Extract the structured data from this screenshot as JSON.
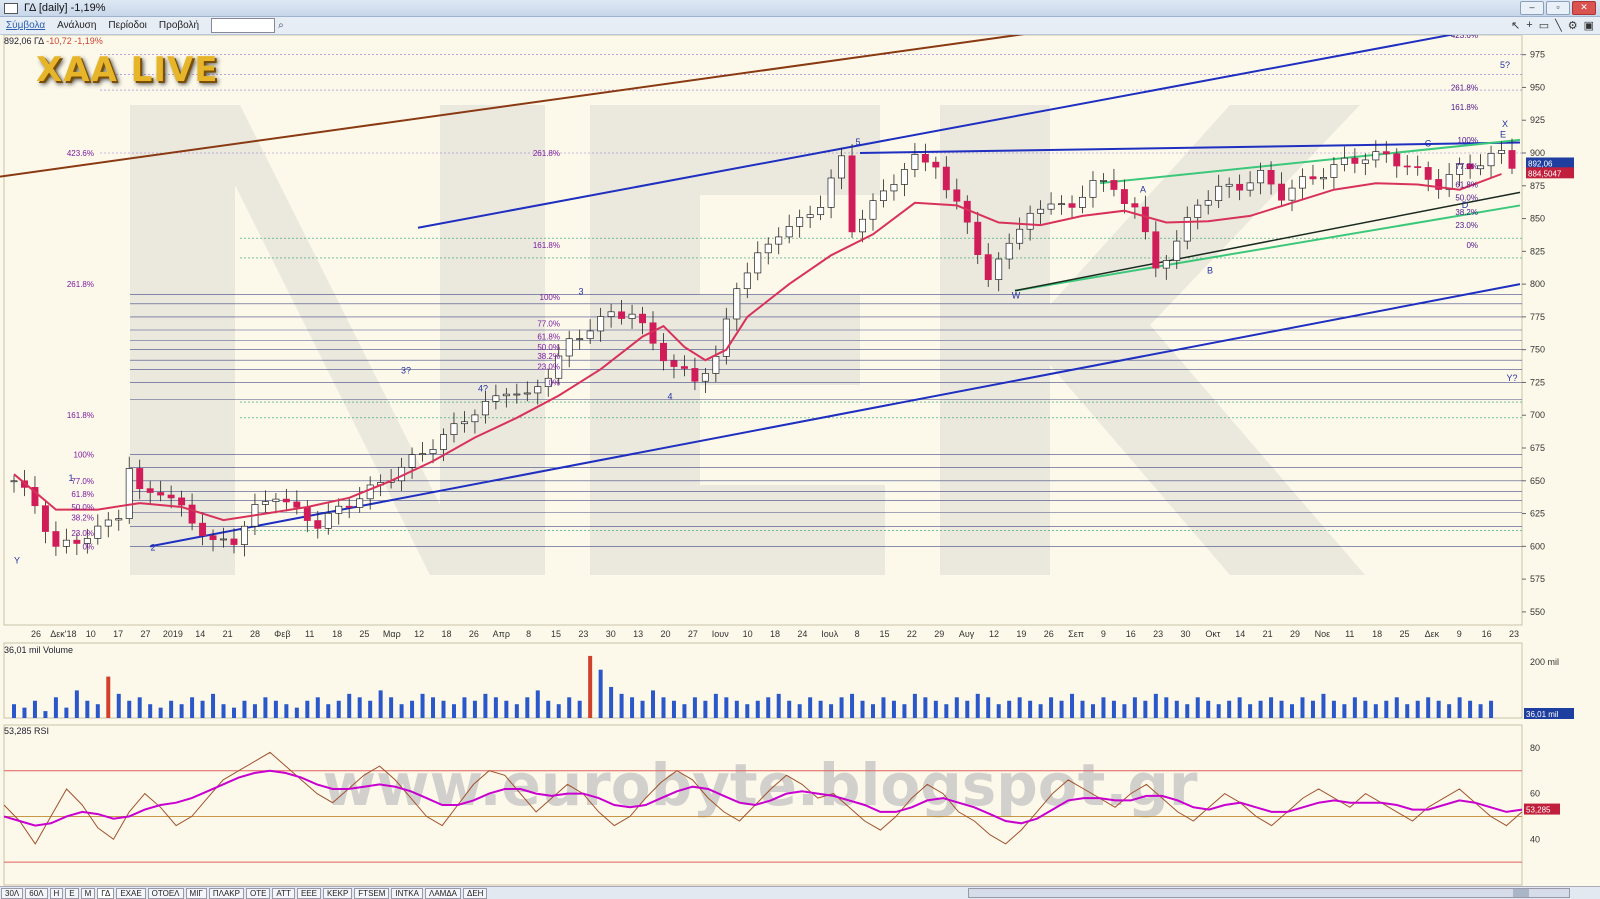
{
  "window": {
    "title": "ΓΔ [daily] -1,19%"
  },
  "menu": {
    "items": [
      "Σύμβολα",
      "Ανάλυση",
      "Περίοδοι",
      "Προβολή"
    ],
    "active_index": 0,
    "search_value": ""
  },
  "info_line": {
    "price": "892,06",
    "symbol": "ΓΔ",
    "change": "-10,72",
    "change_pct": "-1,19%"
  },
  "logo": "XAA LIVE",
  "watermark_url": "www.eurobyte.blogspot.gr",
  "price_tags": {
    "last": "892,06",
    "ma": "884,5047"
  },
  "volume_label": "36,01 mil Volume",
  "volume_tag": "36,01 mil",
  "rsi_label": "53,285 RSI",
  "rsi_tag": "53,285",
  "tabs": [
    "30Λ",
    "60Λ",
    "Η",
    "Ε",
    "Μ",
    "ΓΔ",
    "ΕΧΑΕ",
    "ΟΤΟΕΛ",
    "ΜΙΓ",
    "ΠΛΑΚΡ",
    "ΟΤΕ",
    "ΑΤΤ",
    "ΕΕΕ",
    "ΚΕΚΡ",
    "FTSEM",
    "ΙΝΤΚΑ",
    "ΛΑΜΔΑ",
    "ΔΕΗ"
  ],
  "active_tab": 5,
  "colors": {
    "up": "#ffffff",
    "down": "#d01c58",
    "ma": "#d8325a",
    "blue_line": "#1f2fc0",
    "brown_line": "#8a3a12",
    "green_line": "#3cc87a",
    "rsi_fast": "#a0522d",
    "rsi_slow": "#c800d0",
    "vol_blue": "#2a57c9",
    "vol_red": "#d0402a"
  },
  "chart_data": {
    "type": "candlestick",
    "x_ticks": [
      "26",
      "Δεκ'18",
      "10",
      "17",
      "27",
      "2019",
      "14",
      "21",
      "28",
      "Φεβ",
      "11",
      "18",
      "25",
      "Μαρ",
      "12",
      "18",
      "26",
      "Απρ",
      "8",
      "15",
      "23",
      "30",
      "13",
      "20",
      "27",
      "Ιουν",
      "10",
      "18",
      "24",
      "Ιουλ",
      "8",
      "15",
      "22",
      "29",
      "Αυγ",
      "12",
      "19",
      "26",
      "Σεπ",
      "9",
      "16",
      "23",
      "30",
      "Οκτ",
      "14",
      "21",
      "29",
      "Νοε",
      "11",
      "18",
      "25",
      "Δεκ",
      "9",
      "16",
      "23"
    ],
    "y_ticks": [
      550,
      575,
      600,
      625,
      650,
      675,
      700,
      725,
      750,
      775,
      800,
      825,
      850,
      875,
      900,
      925,
      950,
      975
    ],
    "ylim": [
      540,
      990
    ],
    "close_path": [
      [
        0,
        650
      ],
      [
        2,
        632
      ],
      [
        4,
        598
      ],
      [
        6,
        605
      ],
      [
        8,
        612
      ],
      [
        10,
        625
      ],
      [
        11,
        660
      ],
      [
        12,
        640
      ],
      [
        14,
        643
      ],
      [
        16,
        628
      ],
      [
        17,
        620
      ],
      [
        19,
        602
      ],
      [
        21,
        605
      ],
      [
        23,
        628
      ],
      [
        25,
        640
      ],
      [
        27,
        626
      ],
      [
        29,
        617
      ],
      [
        31,
        628
      ],
      [
        33,
        638
      ],
      [
        35,
        648
      ],
      [
        37,
        660
      ],
      [
        39,
        672
      ],
      [
        41,
        683
      ],
      [
        43,
        698
      ],
      [
        45,
        707
      ],
      [
        47,
        720
      ],
      [
        49,
        713
      ],
      [
        51,
        732
      ],
      [
        53,
        755
      ],
      [
        55,
        767
      ],
      [
        57,
        777
      ],
      [
        59,
        778
      ],
      [
        61,
        755
      ],
      [
        63,
        736
      ],
      [
        65,
        728
      ],
      [
        67,
        742
      ],
      [
        69,
        800
      ],
      [
        71,
        820
      ],
      [
        73,
        840
      ],
      [
        75,
        847
      ],
      [
        77,
        862
      ],
      [
        79,
        895
      ],
      [
        80,
        843
      ],
      [
        82,
        860
      ],
      [
        84,
        880
      ],
      [
        86,
        895
      ],
      [
        88,
        893
      ],
      [
        89,
        870
      ],
      [
        91,
        850
      ],
      [
        93,
        800
      ],
      [
        95,
        835
      ],
      [
        97,
        850
      ],
      [
        99,
        865
      ],
      [
        101,
        855
      ],
      [
        103,
        882
      ],
      [
        105,
        870
      ],
      [
        107,
        860
      ],
      [
        109,
        812
      ],
      [
        111,
        832
      ],
      [
        113,
        862
      ],
      [
        115,
        872
      ],
      [
        117,
        875
      ],
      [
        119,
        883
      ],
      [
        121,
        868
      ],
      [
        123,
        878
      ],
      [
        125,
        885
      ],
      [
        127,
        893
      ],
      [
        129,
        897
      ],
      [
        131,
        898
      ],
      [
        133,
        890
      ],
      [
        134,
        885
      ],
      [
        136,
        876
      ],
      [
        138,
        888
      ],
      [
        140,
        893
      ],
      [
        142,
        900
      ],
      [
        143,
        892
      ]
    ],
    "moving_average": [
      [
        0,
        655
      ],
      [
        4,
        628
      ],
      [
        8,
        628
      ],
      [
        12,
        633
      ],
      [
        16,
        630
      ],
      [
        20,
        620
      ],
      [
        24,
        625
      ],
      [
        28,
        630
      ],
      [
        32,
        637
      ],
      [
        36,
        650
      ],
      [
        40,
        665
      ],
      [
        44,
        683
      ],
      [
        48,
        698
      ],
      [
        52,
        715
      ],
      [
        56,
        735
      ],
      [
        60,
        760
      ],
      [
        62,
        768
      ],
      [
        64,
        752
      ],
      [
        66,
        742
      ],
      [
        68,
        750
      ],
      [
        70,
        775
      ],
      [
        74,
        800
      ],
      [
        78,
        822
      ],
      [
        82,
        838
      ],
      [
        86,
        862
      ],
      [
        90,
        860
      ],
      [
        94,
        847
      ],
      [
        98,
        845
      ],
      [
        102,
        852
      ],
      [
        106,
        856
      ],
      [
        110,
        847
      ],
      [
        114,
        848
      ],
      [
        118,
        852
      ],
      [
        122,
        862
      ],
      [
        126,
        872
      ],
      [
        130,
        877
      ],
      [
        134,
        876
      ],
      [
        138,
        872
      ],
      [
        142,
        884
      ]
    ],
    "volume": [
      4,
      3,
      5,
      2,
      6,
      3,
      8,
      5,
      4,
      12,
      7,
      5,
      6,
      4,
      3,
      5,
      4,
      6,
      5,
      7,
      4,
      3,
      5,
      4,
      6,
      5,
      4,
      3,
      5,
      6,
      4,
      5,
      7,
      6,
      5,
      8,
      6,
      4,
      5,
      7,
      6,
      5,
      4,
      6,
      5,
      7,
      6,
      5,
      4,
      6,
      8,
      5,
      4,
      6,
      5,
      18,
      14,
      9,
      7,
      6,
      5,
      8,
      6,
      5,
      4,
      6,
      5,
      7,
      6,
      5,
      4,
      5,
      6,
      7,
      5,
      4,
      6,
      5,
      4,
      6,
      7,
      5,
      4,
      6,
      5,
      4,
      7,
      6,
      5,
      4,
      6,
      5,
      7,
      6,
      4,
      5,
      6,
      5,
      4,
      6,
      5,
      7,
      5,
      4,
      6,
      5,
      4,
      6,
      5,
      7,
      6,
      5,
      4,
      6,
      5,
      4,
      5,
      6,
      4,
      5,
      6,
      5,
      4,
      6,
      5,
      7,
      5,
      4,
      6,
      5,
      4,
      5,
      6,
      4,
      5,
      6,
      5,
      4,
      6,
      5,
      4,
      5
    ],
    "volume_red_index": [
      55,
      9
    ],
    "volume_axis_label": "200 mil",
    "rsi_levels": [
      30,
      70
    ],
    "rsi_ticks": [
      40,
      60,
      80
    ],
    "rsi_fast": [
      55,
      48,
      38,
      50,
      62,
      55,
      45,
      40,
      52,
      60,
      54,
      46,
      50,
      58,
      66,
      70,
      74,
      78,
      72,
      66,
      60,
      56,
      62,
      68,
      72,
      66,
      58,
      50,
      46,
      55,
      64,
      70,
      68,
      60,
      52,
      58,
      64,
      60,
      52,
      46,
      50,
      58,
      65,
      70,
      66,
      58,
      52,
      48,
      55,
      62,
      68,
      64,
      58,
      60,
      54,
      48,
      44,
      50,
      58,
      64,
      60,
      52,
      48,
      42,
      38,
      44,
      52,
      60,
      66,
      62,
      58,
      54,
      60,
      64,
      58,
      52,
      48,
      54,
      60,
      56,
      50,
      46,
      52,
      58,
      62,
      58,
      54,
      60,
      56,
      52,
      48,
      54,
      58,
      62,
      56,
      50,
      46,
      52
    ],
    "rsi_slow": [
      50,
      48,
      46,
      47,
      50,
      52,
      51,
      49,
      50,
      53,
      55,
      56,
      58,
      61,
      64,
      67,
      69,
      70,
      69,
      67,
      64,
      62,
      62,
      63,
      64,
      63,
      61,
      58,
      55,
      55,
      57,
      60,
      62,
      62,
      60,
      59,
      60,
      60,
      58,
      55,
      54,
      55,
      58,
      61,
      63,
      62,
      59,
      56,
      55,
      57,
      60,
      61,
      60,
      59,
      57,
      55,
      52,
      52,
      54,
      57,
      58,
      56,
      54,
      51,
      48,
      47,
      49,
      53,
      57,
      58,
      58,
      57,
      57,
      59,
      59,
      57,
      54,
      53,
      55,
      56,
      54,
      52,
      52,
      54,
      56,
      57,
      56,
      56,
      56,
      55,
      53,
      53,
      55,
      57,
      56,
      54,
      52,
      53
    ],
    "annotations": {
      "fib_labels_left": [
        "423.6%",
        "261.8%",
        "161.8%",
        "100%",
        "77.0%",
        "61.8%",
        "50.0%",
        "38.2%",
        "23.0%",
        "0%"
      ],
      "fib_labels_mid": [
        "261.8%",
        "161.8%",
        "100%",
        "77.0%",
        "61.8%",
        "50.0%",
        "38.2%",
        "23.0%",
        "0%"
      ],
      "fib_labels_right": [
        "423.6%",
        "261.8%",
        "161.8%",
        "100%",
        "77.0%",
        "61.8%",
        "50.0%",
        "38.2%",
        "23.0%",
        "0%"
      ],
      "wave_labels": [
        "1",
        "2",
        "3",
        "4",
        "5",
        "3?",
        "4?",
        "5?",
        "A",
        "B",
        "C",
        "D",
        "E",
        "W",
        "X",
        "Y",
        "Y?"
      ]
    }
  }
}
